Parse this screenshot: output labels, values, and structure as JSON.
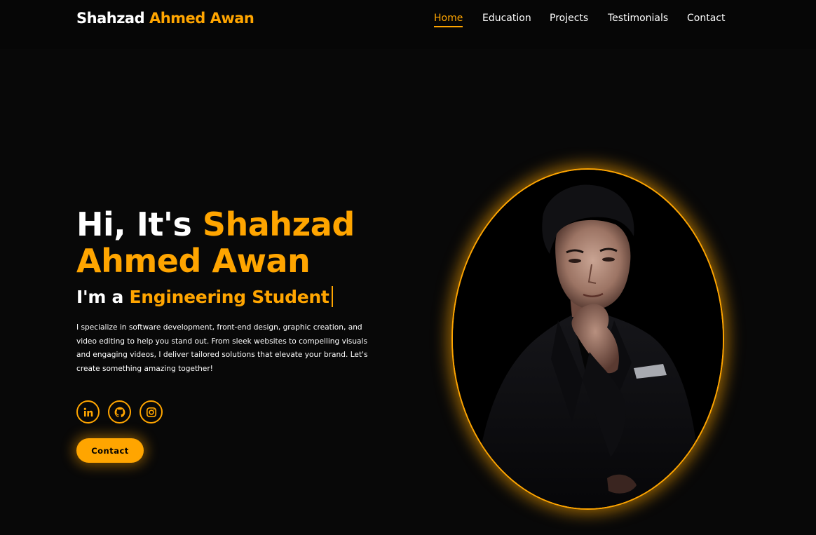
{
  "header": {
    "logo_first": "Shahzad",
    "logo_rest": "Ahmed Awan"
  },
  "nav": {
    "items": [
      {
        "label": "Home",
        "active": true
      },
      {
        "label": "Education",
        "active": false
      },
      {
        "label": "Projects",
        "active": false
      },
      {
        "label": "Testimonials",
        "active": false
      },
      {
        "label": "Contact",
        "active": false
      }
    ]
  },
  "hero": {
    "greeting": "Hi, It's",
    "name_line1": "Shahzad",
    "name_line2": "Ahmed Awan",
    "subtitle_prefix": "I'm a",
    "subtitle_role": "Engineering Student",
    "description": "I specialize in software development, front-end design, graphic creation, and video editing to help you stand out. From sleek websites to compelling visuals and engaging videos, I deliver tailored solutions that elevate your brand. Let's create something amazing together!",
    "contact_label": "Contact"
  },
  "socials": [
    {
      "icon": "linkedin-icon"
    },
    {
      "icon": "github-icon"
    },
    {
      "icon": "instagram-icon"
    }
  ],
  "portrait": {
    "subject": "portrait-photo"
  },
  "colors": {
    "accent": "#ffa500",
    "background": "#080808",
    "header_background": "#060606",
    "text": "#ffffff"
  }
}
